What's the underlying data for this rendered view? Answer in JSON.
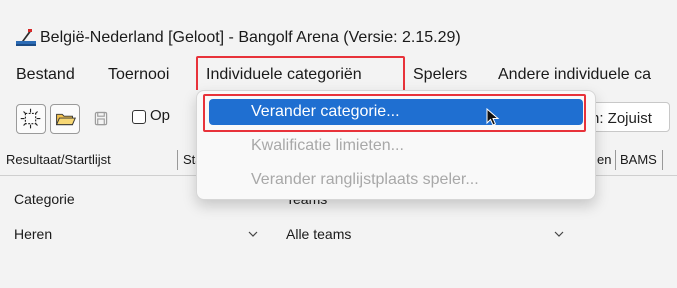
{
  "window": {
    "title": "België-Nederland [Geloot] - Bangolf Arena (Versie: 2.15.29)",
    "icon": "bangolf-app-icon"
  },
  "menubar": {
    "items": [
      "Bestand",
      "Toernooi",
      "Individuele categoriën",
      "Spelers",
      "Andere individuele ca"
    ]
  },
  "toolbar": {
    "checkbox_label": "Op",
    "date_text": "n: Zojuist"
  },
  "tabs": [
    "Resultaat/Startlijst",
    "Sta",
    "en",
    "BAMS"
  ],
  "filters": {
    "category_label": "Categorie",
    "category_value": "Heren",
    "teams_label": "Teams",
    "teams_value": "Alle teams"
  },
  "dropdown": {
    "items": [
      {
        "label": "Verander categorie...",
        "state": "highlighted"
      },
      {
        "label": "Kwalificatie limieten...",
        "state": "disabled"
      },
      {
        "label": "Verander ranglijstplaats speler...",
        "state": "disabled"
      }
    ]
  },
  "colors": {
    "highlight_red": "#e8323a",
    "selection_blue": "#1f6fd1",
    "disabled_text": "#a8a8a8"
  }
}
